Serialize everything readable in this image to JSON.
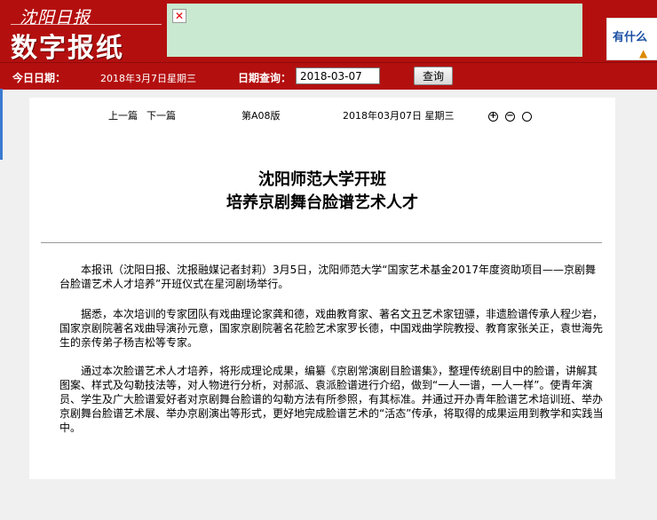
{
  "header": {
    "logo_small": "沈阳日报",
    "logo_big": "数字报纸",
    "broken_image": "✕",
    "ad_text": "有什么",
    "ad_mark": "▲"
  },
  "toolbar": {
    "today_label": "今日日期：",
    "today_value": "2018年3月7日星期三",
    "query_label": "日期查询：",
    "query_value": "2018-03-07",
    "query_button": "查询"
  },
  "nav": {
    "prev": "上一篇",
    "next": "下一篇",
    "page": "第A08版",
    "date": "2018年03月07日 星期三"
  },
  "zoom": {
    "in": "+",
    "out": "−",
    "reset": ""
  },
  "article": {
    "title_line1": "沈阳师范大学开班",
    "title_line2": "培养京剧舞台脸谱艺术人才",
    "paragraphs": [
      "本报讯（沈阳日报、沈报融媒记者封莉）3月5日，沈阳师范大学“国家艺术基金2017年度资助项目——京剧舞台脸谱艺术人才培养”开班仪式在星河剧场举行。",
      "据悉，本次培训的专家团队有戏曲理论家龚和德，戏曲教育家、著名文丑艺术家钮骠，非遗脸谱传承人程少岩，国家京剧院著名戏曲导演孙元意，国家京剧院著名花脸艺术家罗长德，中国戏曲学院教授、教育家张关正，袁世海先生的亲传弟子杨吉松等专家。",
      "通过本次脸谱艺术人才培养，将形成理论成果，编纂《京剧常演剧目脸谱集》，整理传统剧目中的脸谱，讲解其图案、样式及勾勒技法等，对人物进行分析，对郝派、袁派脸谱进行介绍，做到“一人一谱，一人一样”。使青年演员、学生及广大脸谱爱好者对京剧舞台脸谱的勾勒方法有所参照，有其标准。并通过开办青年脸谱艺术培训班、举办京剧舞台脸谱艺术展、举办京剧演出等形式，更好地完成脸谱艺术的“活态”传承，将取得的成果运用到教学和实践当中。"
    ]
  }
}
